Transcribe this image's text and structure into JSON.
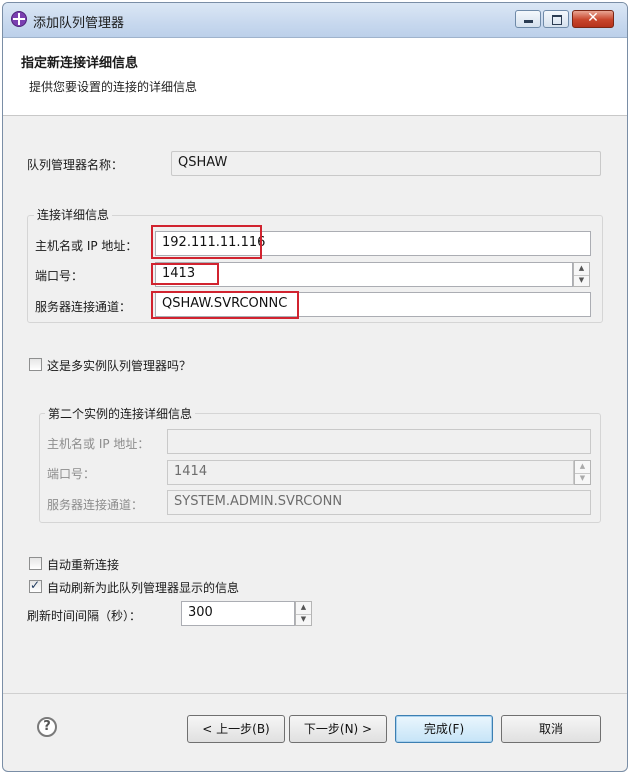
{
  "window": {
    "title": "添加队列管理器"
  },
  "banner": {
    "title": "指定新连接详细信息",
    "description": "提供您要设置的连接的详细信息"
  },
  "qmgr": {
    "name_label": "队列管理器名称：",
    "name_value": "QSHAW"
  },
  "connection": {
    "group_title": "连接详细信息",
    "host_label": "主机名或 IP 地址：",
    "host_value": "192.111.11.116",
    "port_label": "端口号：",
    "port_value": "1413",
    "channel_label": "服务器连接通道：",
    "channel_value": "QSHAW.SVRCONNC"
  },
  "multi_instance": {
    "label": "这是多实例队列管理器吗？",
    "checked": false
  },
  "second_instance": {
    "group_title": "第二个实例的连接详细信息",
    "host_label": "主机名或 IP 地址：",
    "host_value": "",
    "port_label": "端口号：",
    "port_value": "1414",
    "channel_label": "服务器连接通道：",
    "channel_value": "SYSTEM.ADMIN.SVRCONN"
  },
  "options": {
    "auto_reconnect_label": "自动重新连接",
    "auto_reconnect_checked": false,
    "auto_refresh_label": "自动刷新为此队列管理器显示的信息",
    "auto_refresh_checked": true,
    "refresh_interval_label": "刷新时间间隔（秒）：",
    "refresh_interval_value": "300"
  },
  "buttons": {
    "back": "< 上一步(B)",
    "next": "下一步(N) >",
    "finish": "完成(F)",
    "cancel": "取消"
  },
  "colors": {
    "highlight": "#d1232f",
    "titlebar": "#c7d8ee"
  }
}
